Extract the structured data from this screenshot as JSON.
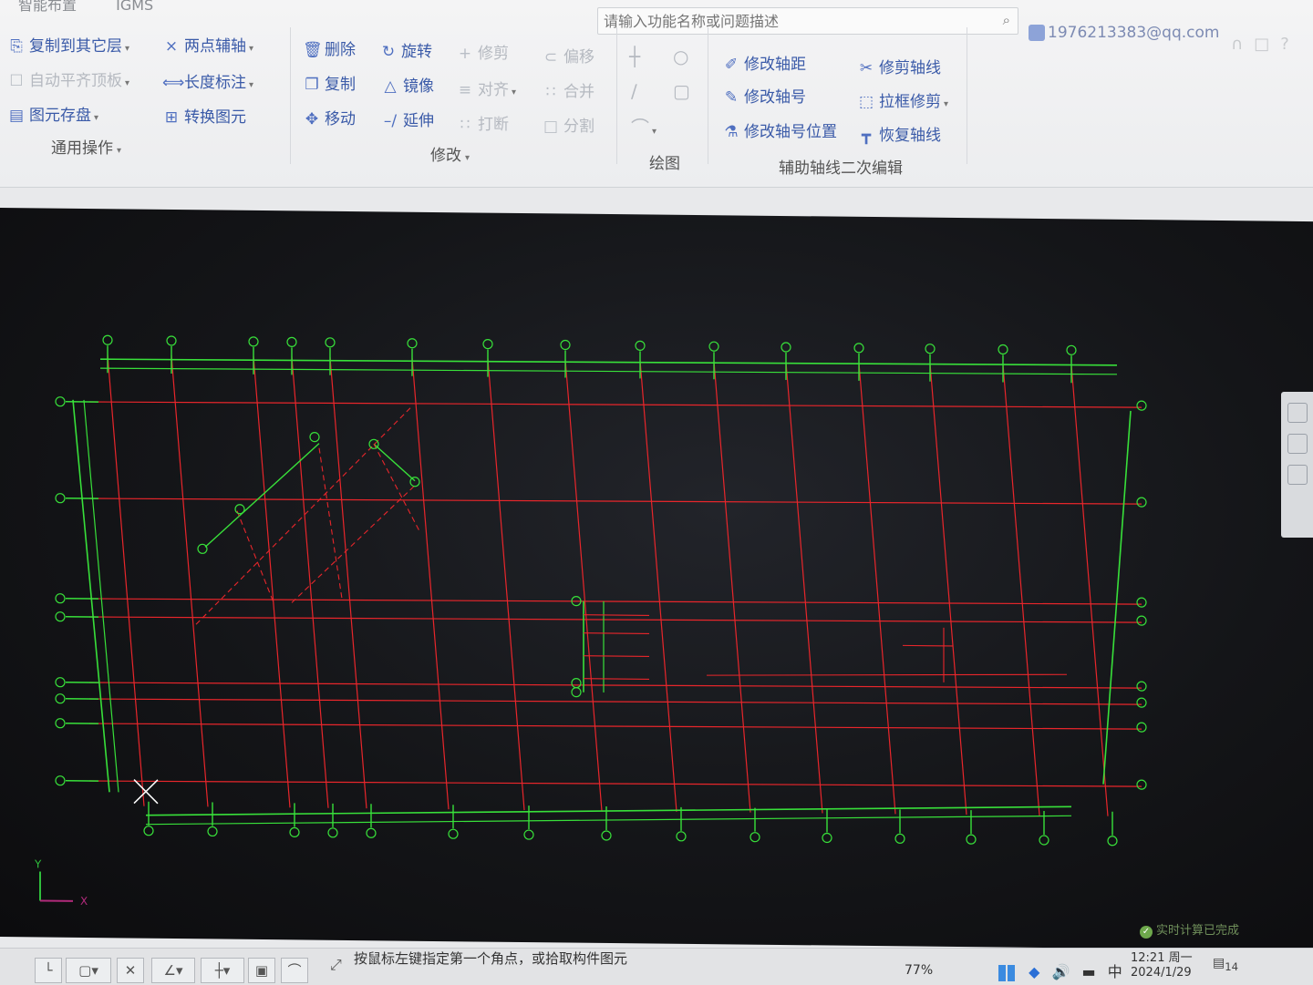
{
  "app": {
    "top_tabs": [
      "智能布置",
      "IGMS"
    ],
    "search_placeholder": "请输入功能名称或问题描述",
    "user_email": "1976213383@qq.com"
  },
  "ribbon": {
    "general": {
      "group_label": "通用操作",
      "copy_to_other_floor": "复制到其它层",
      "auto_level_slab": "自动平齐顶板",
      "element_storage": "图元存盘",
      "two_point_axis": "两点辅轴",
      "length_dimension": "长度标注",
      "convert_element": "转换图元"
    },
    "modify": {
      "group_label": "修改",
      "delete": "删除",
      "rotate": "旋转",
      "trim": "修剪",
      "offset": "偏移",
      "copy": "复制",
      "mirror": "镜像",
      "align": "对齐",
      "merge": "合并",
      "move": "移动",
      "extend": "延伸",
      "break": "打断",
      "split": "分割"
    },
    "draw": {
      "group_label": "绘图"
    },
    "aux_axis": {
      "group_label": "辅助轴线二次编辑",
      "modify_spacing": "修改轴距",
      "modify_number": "修改轴号",
      "modify_number_position": "修改轴号位置",
      "trim_axis": "修剪轴线",
      "box_trim": "拉框修剪",
      "restore_axis": "恢复轴线"
    }
  },
  "canvas": {
    "realtime_status": "实时计算已完成",
    "axis_y": "Y",
    "axis_x": "X"
  },
  "status_bar": {
    "prompt": "按鼠标左键指定第一个角点，或拾取构件图元",
    "zoom": "77%",
    "ime": "中",
    "time": "12:21 周一",
    "date": "2024/1/29",
    "notification_count": "14"
  },
  "colors": {
    "axis_green": "#38e03a",
    "grid_red": "#e8262b",
    "ribbon_blue": "#3a5aa8",
    "canvas_bg": "#141518"
  }
}
